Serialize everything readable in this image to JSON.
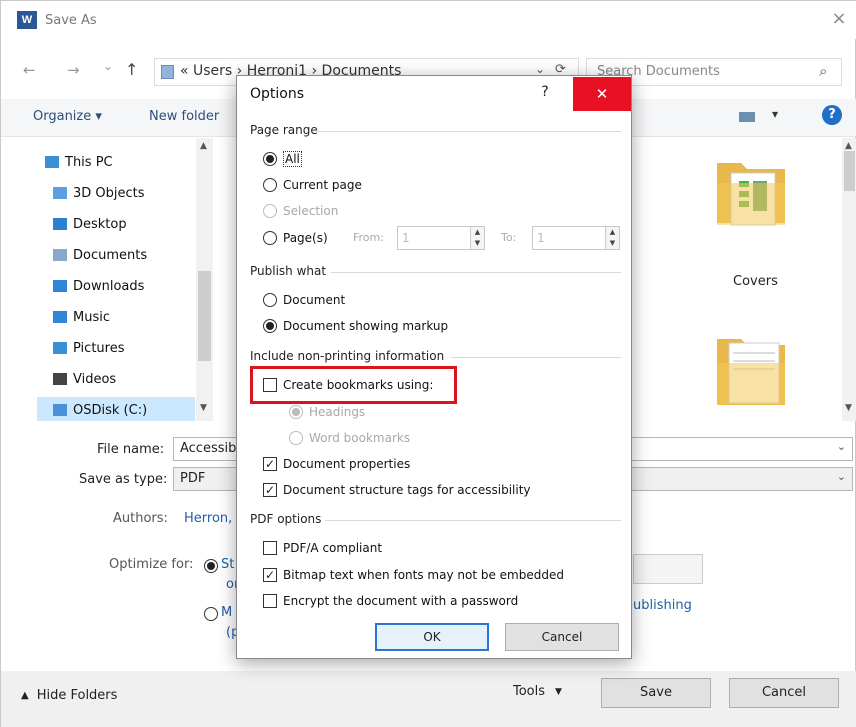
{
  "window": {
    "title": "Save As",
    "close_glyph": "×"
  },
  "nav_bar": {
    "back": "←",
    "forward": "→",
    "recent": "⌄",
    "up": "↑",
    "address": "« Users › Herroni1 › Documents",
    "refresh": "⟳",
    "search_placeholder": "Search Documents",
    "search_icon": "⌕"
  },
  "toolbar": {
    "organize": "Organize ▾",
    "new_folder": "New folder",
    "view": "▾",
    "help": "?"
  },
  "sidebar": {
    "items": [
      {
        "label": "This PC",
        "icon": "pc-icon",
        "color": "#3a8fd6"
      },
      {
        "label": "3D Objects",
        "icon": "cube-icon",
        "color": "#5aa0e0"
      },
      {
        "label": "Desktop",
        "icon": "desktop-icon",
        "color": "#2f7fd0"
      },
      {
        "label": "Documents",
        "icon": "document-icon",
        "color": "#8aa8c8"
      },
      {
        "label": "Downloads",
        "icon": "download-icon",
        "color": "#2f86d8"
      },
      {
        "label": "Music",
        "icon": "music-icon",
        "color": "#2f86d8"
      },
      {
        "label": "Pictures",
        "icon": "picture-icon",
        "color": "#3a8fd6"
      },
      {
        "label": "Videos",
        "icon": "video-icon",
        "color": "#444"
      },
      {
        "label": "OSDisk (C:)",
        "icon": "disk-icon",
        "color": "#4a90d9"
      }
    ]
  },
  "files": {
    "covers_label": "Covers"
  },
  "form": {
    "file_name_label": "File name:",
    "file_name_value": "Accessib",
    "save_type_label": "Save as type:",
    "save_type_value": "PDF",
    "authors_label": "Authors:",
    "authors_value": "Herron, ",
    "optimize_label": "Optimize for:",
    "opt_standard_frag1": "St",
    "opt_standard_frag2": "or",
    "opt_min_frag1": "M",
    "opt_min_frag2": "(p",
    "publishing_link": "ublishing"
  },
  "bottom_bar": {
    "hide_folders": "Hide Folders",
    "tools": "Tools",
    "save": "Save",
    "cancel": "Cancel"
  },
  "options_dialog": {
    "title": "Options",
    "help": "?",
    "close": "✕",
    "page_range": {
      "heading": "Page range",
      "all": "All",
      "current_page": "Current page",
      "selection": "Selection",
      "pages": "Page(s)",
      "from_label": "From:",
      "from_value": "1",
      "to_label": "To:",
      "to_value": "1",
      "selected": "all"
    },
    "publish_what": {
      "heading": "Publish what",
      "document": "Document",
      "document_markup": "Document showing markup",
      "selected": "document_markup"
    },
    "non_printing": {
      "heading": "Include non-printing information",
      "create_bookmarks": "Create bookmarks using:",
      "create_bookmarks_checked": false,
      "headings": "Headings",
      "word_bookmarks": "Word bookmarks",
      "doc_properties": "Document properties",
      "doc_properties_checked": true,
      "structure_tags": "Document structure tags for accessibility",
      "structure_tags_checked": true
    },
    "pdf_options": {
      "heading": "PDF options",
      "pdfa": "PDF/A compliant",
      "pdfa_checked": false,
      "bitmap_text": "Bitmap text when fonts may not be embedded",
      "bitmap_text_checked": true,
      "encrypt": "Encrypt the document with a password",
      "encrypt_checked": false
    },
    "ok": "OK",
    "cancel": "Cancel"
  },
  "colors": {
    "highlight_box": "#d9141f",
    "close_red": "#e81123",
    "accent_blue": "#2a76d2",
    "folder_yellow": "#f3c95a"
  }
}
